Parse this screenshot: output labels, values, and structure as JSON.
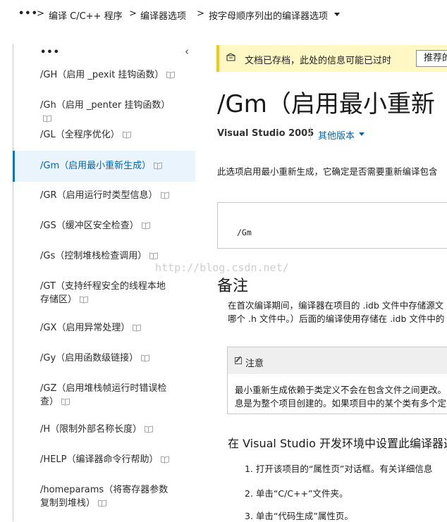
{
  "breadcrumb": {
    "more": "•••",
    "separator": ">",
    "items": [
      "编译 C/C++ 程序",
      "编译器选项",
      "按字母顺序列出的编译器选项"
    ]
  },
  "toc": {
    "more": "•••",
    "collapse_icon": "chevron-left-icon",
    "items": [
      {
        "label": "/GH（启用 _pexit 挂钩函数）",
        "active": false
      },
      {
        "label": "/Gh（启用 _penter 挂钩函数）",
        "active": false
      },
      {
        "label": "/GL（全程序优化）",
        "active": false
      },
      {
        "label": "/Gm（启用最小重新生成）",
        "active": true
      },
      {
        "label": "/GR（启用运行时类型信息）",
        "active": false
      },
      {
        "label": "/GS（缓冲区安全检查）",
        "active": false
      },
      {
        "label": "/Gs（控制堆栈检查调用）",
        "active": false
      },
      {
        "label": "/GT（支持纤程安全的线程本地存储区）",
        "active": false
      },
      {
        "label": "/GX（启用异常处理）",
        "active": false
      },
      {
        "label": "/Gy（启用函数级链接）",
        "active": false
      },
      {
        "label": "/GZ（启用堆栈帧运行时错误检查）",
        "active": false
      },
      {
        "label": "/H（限制外部名称长度）",
        "active": false
      },
      {
        "label": "/HELP（编译器命令行帮助）",
        "active": false
      },
      {
        "label": "/homeparams（将寄存器参数复制到堆栈）",
        "active": false
      }
    ],
    "accent_color": "#0078d4"
  },
  "notice": {
    "text": "文档已存档，此处的信息可能已过时",
    "button": "推荐的"
  },
  "article": {
    "title": "/Gm（启用最小重新",
    "version": "Visual Studio 2005",
    "other_versions": "其他版本",
    "intro": "此选项启用最小重新生成，它确定是否需要重新编译包含",
    "code": "/Gm",
    "remarks_heading": "备注",
    "remarks_lines": [
      "在首次编译期间，编译器在项目的 .idb 文件中存储源文",
      "哪个 .h 文件中。）后面的编译使用存储在 .idb 文件中的"
    ],
    "note": {
      "label": "注意",
      "lines": [
        "最小重新生成依赖于类定义不会在包含文件之间更改。",
        "息是为整个项目创建的。如果项目中的某个类有多个定"
      ]
    },
    "ide_heading": "在 Visual Studio 开发环境中设置此编译器选",
    "steps": [
      "1. 打开该项目的“属性页”对话框。有关详细信息",
      "2. 单击“C/C++”文件夹。",
      "3. 单击“代码生成”属性页。"
    ]
  },
  "watermark": "http://blog.csdn.net/"
}
